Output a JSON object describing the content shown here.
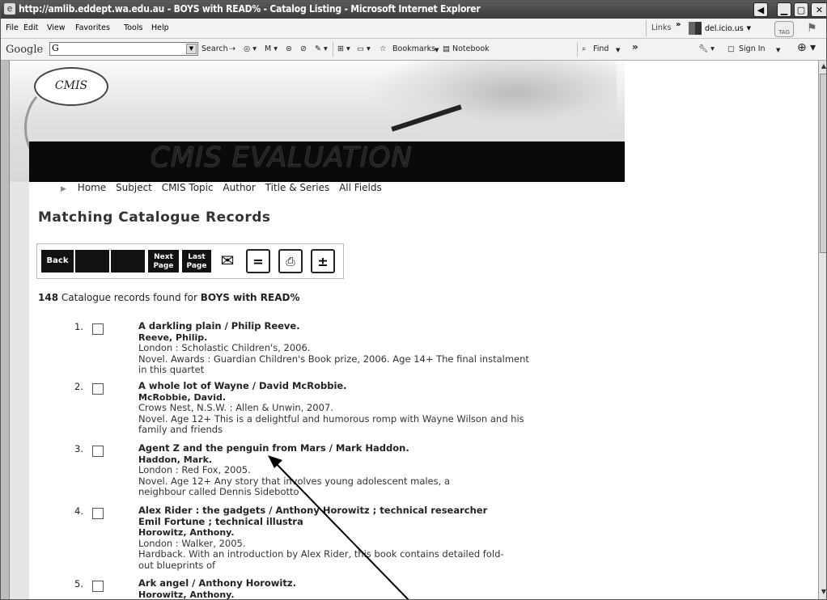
{
  "window": {
    "title": "http://amlib.eddept.wa.edu.au - BOYS with READ% - Catalog Listing - Microsoft Internet Explorer"
  },
  "menubar": {
    "items": [
      "File",
      "Edit",
      "View",
      "Favorites",
      "Tools",
      "Help"
    ],
    "links_label": "Links",
    "delicious_label": "del.icio.us",
    "tag_label": "TAG"
  },
  "googlebar": {
    "logo": "Google",
    "search_prefix": "G",
    "search_label": "Search",
    "bookmarks_label": "Bookmarks",
    "notebook_label": "Notebook",
    "find_label": "Find",
    "signin_label": "Sign In"
  },
  "banner": {
    "logo_text": "CMIS",
    "title": "CMIS EVALUATION"
  },
  "nav": {
    "items": [
      "Home",
      "Subject",
      "CMIS Topic",
      "Author",
      "Title & Series",
      "All Fields"
    ]
  },
  "page": {
    "heading": "Matching Catalogue Records",
    "count": "148",
    "count_text": " Catalogue records found for ",
    "query": "BOYS with READ%"
  },
  "toolbar": {
    "back_label": "Back",
    "next_label_1": "Next",
    "next_label_2": "Page",
    "last_label_1": "Last",
    "last_label_2": "Page"
  },
  "records": [
    {
      "num": "1.",
      "title": "A darkling plain / Philip Reeve.",
      "author": "Reeve, Philip.",
      "pub": "London : Scholastic Children's, 2006.",
      "note": "Novel. Awards : Guardian Children's Book prize, 2006. Age 14+ The final instalment in this quartet"
    },
    {
      "num": "2.",
      "title": "A whole lot of Wayne / David McRobbie.",
      "author": "McRobbie, David.",
      "pub": "Crows Nest, N.S.W. : Allen & Unwin, 2007.",
      "note": "Novel. Age 12+ This is a delightful and humorous romp with Wayne Wilson and his family and friends"
    },
    {
      "num": "3.",
      "title": "Agent Z and the penguin from Mars / Mark Haddon.",
      "author": "Haddon, Mark.",
      "pub": "London : Red Fox, 2005.",
      "note": "Novel. Age 12+ Any story that involves young adolescent males, a neighbour called Dennis Sidebotto"
    },
    {
      "num": "4.",
      "title": "Alex Rider : the gadgets / Anthony Horowitz ; technical researcher Emil Fortune ; technical illustra",
      "author": "Horowitz, Anthony.",
      "pub": "London : Walker, 2005.",
      "note": "Hardback. With an introduction by Alex Rider, this book contains detailed fold- out blueprints of"
    },
    {
      "num": "5.",
      "title": "Ark angel / Anthony Horowitz.",
      "author": "Horowitz, Anthony.",
      "pub": "",
      "note": ""
    }
  ]
}
